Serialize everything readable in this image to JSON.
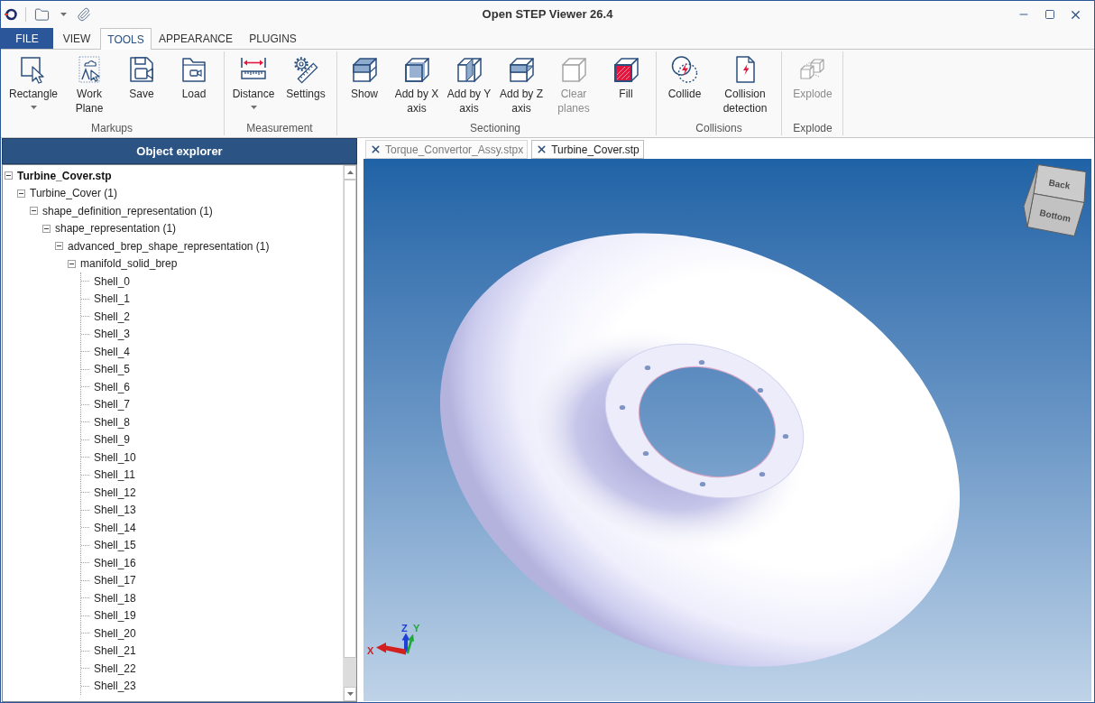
{
  "window": {
    "title": "Open STEP Viewer 26.4"
  },
  "ribbon_tabs": [
    {
      "label": "FILE",
      "kind": "menu",
      "selected": false
    },
    {
      "label": "VIEW",
      "kind": "tab",
      "selected": false
    },
    {
      "label": "TOOLS",
      "kind": "tab",
      "selected": true
    },
    {
      "label": "APPEARANCE",
      "kind": "tab",
      "selected": false
    },
    {
      "label": "PLUGINS",
      "kind": "tab",
      "selected": false
    }
  ],
  "ribbon_groups": [
    {
      "label": "Markups",
      "buttons": [
        {
          "label": "Rectangle",
          "dropdown": true,
          "disabled": false
        },
        {
          "label": "Work Plane",
          "dropdown": false,
          "disabled": false
        },
        {
          "label": "Save",
          "dropdown": false,
          "disabled": false
        },
        {
          "label": "Load",
          "dropdown": false,
          "disabled": false
        }
      ]
    },
    {
      "label": "Measurement",
      "buttons": [
        {
          "label": "Distance",
          "dropdown": true,
          "disabled": false
        },
        {
          "label": "Settings",
          "dropdown": false,
          "disabled": false
        }
      ]
    },
    {
      "label": "Sectioning",
      "buttons": [
        {
          "label": "Show",
          "dropdown": false,
          "disabled": false
        },
        {
          "label": "Add by X axis",
          "dropdown": false,
          "disabled": false
        },
        {
          "label": "Add by Y axis",
          "dropdown": false,
          "disabled": false
        },
        {
          "label": "Add by Z axis",
          "dropdown": false,
          "disabled": false
        },
        {
          "label": "Clear planes",
          "dropdown": false,
          "disabled": true
        },
        {
          "label": "Fill",
          "dropdown": false,
          "disabled": false
        }
      ]
    },
    {
      "label": "Collisions",
      "buttons": [
        {
          "label": "Collide",
          "dropdown": false,
          "disabled": false
        },
        {
          "label": "Collision detection",
          "dropdown": false,
          "disabled": false
        }
      ]
    },
    {
      "label": "Explode",
      "buttons": [
        {
          "label": "Explode",
          "dropdown": false,
          "disabled": true
        }
      ]
    }
  ],
  "object_explorer": {
    "title": "Object explorer",
    "tree": [
      {
        "label": "Turbine_Cover.stp",
        "expanded": true,
        "children": [
          {
            "label": "Turbine_Cover (1)",
            "expanded": true,
            "children": [
              {
                "label": "shape_definition_representation (1)",
                "expanded": true,
                "children": [
                  {
                    "label": "shape_representation (1)",
                    "expanded": true,
                    "children": [
                      {
                        "label": "advanced_brep_shape_representation (1)",
                        "expanded": true,
                        "children": [
                          {
                            "label": "manifold_solid_brep",
                            "expanded": true,
                            "children": [
                              {
                                "label": "Shell_0"
                              },
                              {
                                "label": "Shell_1"
                              },
                              {
                                "label": "Shell_2"
                              },
                              {
                                "label": "Shell_3"
                              },
                              {
                                "label": "Shell_4"
                              },
                              {
                                "label": "Shell_5"
                              },
                              {
                                "label": "Shell_6"
                              },
                              {
                                "label": "Shell_7"
                              },
                              {
                                "label": "Shell_8"
                              },
                              {
                                "label": "Shell_9"
                              },
                              {
                                "label": "Shell_10"
                              },
                              {
                                "label": "Shell_11"
                              },
                              {
                                "label": "Shell_12"
                              },
                              {
                                "label": "Shell_13"
                              },
                              {
                                "label": "Shell_14"
                              },
                              {
                                "label": "Shell_15"
                              },
                              {
                                "label": "Shell_16"
                              },
                              {
                                "label": "Shell_17"
                              },
                              {
                                "label": "Shell_18"
                              },
                              {
                                "label": "Shell_19"
                              },
                              {
                                "label": "Shell_20"
                              },
                              {
                                "label": "Shell_21"
                              },
                              {
                                "label": "Shell_22"
                              },
                              {
                                "label": "Shell_23"
                              }
                            ]
                          }
                        ]
                      }
                    ]
                  }
                ]
              }
            ]
          }
        ]
      }
    ]
  },
  "document_tabs": [
    {
      "label": "Torque_Convertor_Assy.stpx",
      "selected": false
    },
    {
      "label": "Turbine_Cover.stp",
      "selected": true
    }
  ],
  "viewport": {
    "view_cube": [
      {
        "label": "Back"
      },
      {
        "label": "Bottom"
      }
    ],
    "axes": [
      {
        "label": "Z",
        "color": "#1f3fd6"
      },
      {
        "label": "Y",
        "color": "#1fa83a"
      },
      {
        "label": "X",
        "color": "#d41f1f"
      }
    ]
  }
}
